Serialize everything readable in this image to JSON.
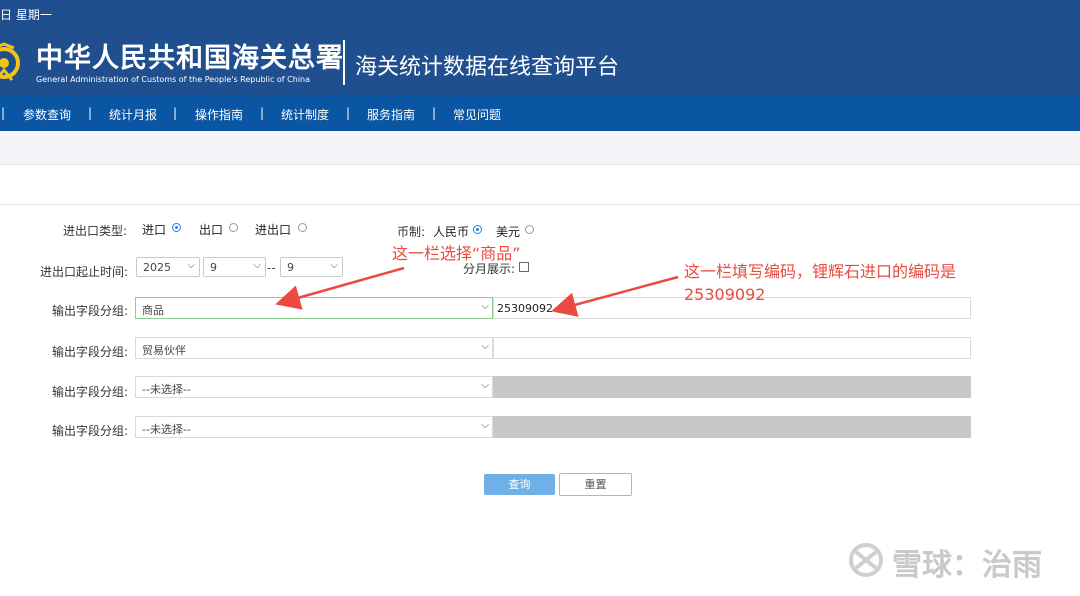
{
  "header": {
    "date_text": "日 星期一",
    "org_name_cn": "中华人民共和国海关总署",
    "org_name_en": "General Administration of Customs of the People's Republic of China",
    "platform_title": "海关统计数据在线查询平台"
  },
  "nav": {
    "items": [
      "参数查询",
      "统计月报",
      "操作指南",
      "统计制度",
      "服务指南",
      "常见问题"
    ],
    "separator": "|"
  },
  "form": {
    "trade_type": {
      "label": "进出口类型:",
      "options": [
        "进口",
        "出口",
        "进出口"
      ],
      "selected": "进口"
    },
    "currency": {
      "label": "币制:",
      "options": [
        "人民币",
        "美元"
      ],
      "selected": "人民币"
    },
    "period": {
      "label": "进出口起止时间:",
      "year": "2025",
      "month_start": "9",
      "sep": "--",
      "month_end": "9",
      "monthly_display_label": "分月展示:",
      "monthly_display_checked": false
    },
    "groups": [
      {
        "label": "输出字段分组:",
        "value": "商品",
        "code": "25309092",
        "code_disabled": false
      },
      {
        "label": "输出字段分组:",
        "value": "贸易伙伴",
        "code": "",
        "code_disabled": false
      },
      {
        "label": "输出字段分组:",
        "value": "--未选择--",
        "code": "",
        "code_disabled": true
      },
      {
        "label": "输出字段分组:",
        "value": "--未选择--",
        "code": "",
        "code_disabled": true
      }
    ],
    "buttons": {
      "query": "查询",
      "reset": "重置"
    }
  },
  "annotations": {
    "select_goods": "这一栏选择“商品”",
    "code_line1": "这一栏填写编码，锂辉石进口的编码是",
    "code_line2": "25309092",
    "color": "#ea4a3f"
  },
  "watermark": {
    "text": "雪球：治雨"
  },
  "colors": {
    "header_bg": "#1f4f8e",
    "nav_bg": "#0a56a3",
    "query_button": "#6fb1e6",
    "disabled_field": "#c8c8c8"
  }
}
